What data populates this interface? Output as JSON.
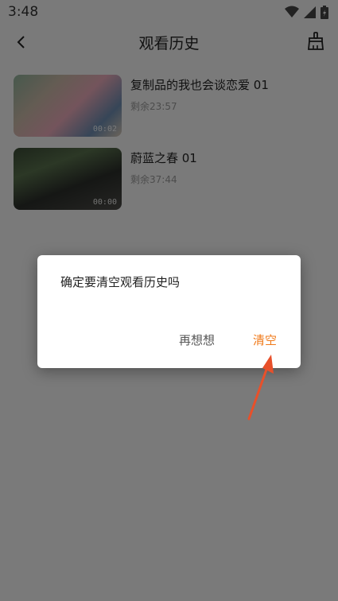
{
  "status_bar": {
    "time": "3:48",
    "icons": [
      "wifi-icon",
      "signal-icon",
      "battery-icon"
    ]
  },
  "app_bar": {
    "title": "观看历史",
    "back_icon": "chevron-left-icon",
    "clear_icon": "broom-icon"
  },
  "history": [
    {
      "title": "复制品的我也会谈恋爱 01",
      "remaining": "剩余23:57",
      "duration": "00:02"
    },
    {
      "title": "蔚蓝之春 01",
      "remaining": "剩余37:44",
      "duration": "00:00"
    }
  ],
  "dialog": {
    "message": "确定要清空观看历史吗",
    "cancel_label": "再想想",
    "confirm_label": "清空"
  },
  "colors": {
    "accent": "#f07a1a",
    "annotation_arrow": "#e8502a"
  }
}
